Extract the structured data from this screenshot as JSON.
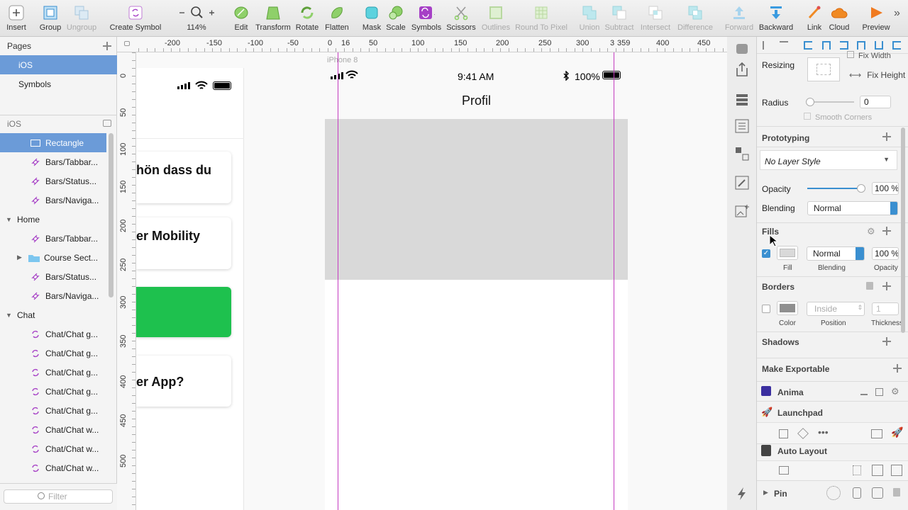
{
  "toolbar": {
    "insert": "Insert",
    "group": "Group",
    "ungroup": "Ungroup",
    "create_symbol": "Create Symbol",
    "zoom": "114%",
    "edit": "Edit",
    "transform": "Transform",
    "rotate": "Rotate",
    "flatten": "Flatten",
    "mask": "Mask",
    "scale": "Scale",
    "symbols": "Symbols",
    "scissors": "Scissors",
    "outlines": "Outlines",
    "round_to_pixel": "Round To Pixel",
    "union": "Union",
    "subtract": "Subtract",
    "intersect": "Intersect",
    "difference": "Difference",
    "forward": "Forward",
    "backward": "Backward",
    "link": "Link",
    "cloud": "Cloud",
    "preview": "Preview"
  },
  "pages": {
    "title": "Pages",
    "items": [
      "iOS",
      "Symbols"
    ],
    "selected": "iOS"
  },
  "layers": {
    "page_name": "iOS",
    "rows": [
      {
        "label": "Rectangle",
        "icon": "rectangle-icon",
        "selected": true
      },
      {
        "label": "Bars/Tabbar...",
        "icon": "symbol-instance-icon"
      },
      {
        "label": "Bars/Status...",
        "icon": "symbol-instance-icon"
      },
      {
        "label": "Bars/Naviga...",
        "icon": "symbol-instance-icon"
      },
      {
        "label": "Home",
        "icon": "artboard-expanded"
      },
      {
        "label": "Bars/Tabbar...",
        "icon": "symbol-instance-icon"
      },
      {
        "label": "Course Sect...",
        "icon": "folder-icon"
      },
      {
        "label": "Bars/Status...",
        "icon": "symbol-instance-icon"
      },
      {
        "label": "Bars/Naviga...",
        "icon": "symbol-instance-icon"
      },
      {
        "label": "Chat",
        "icon": "artboard-expanded"
      },
      {
        "label": "Chat/Chat g...",
        "icon": "symbol-master-icon"
      },
      {
        "label": "Chat/Chat g...",
        "icon": "symbol-master-icon"
      },
      {
        "label": "Chat/Chat g...",
        "icon": "symbol-master-icon"
      },
      {
        "label": "Chat/Chat g...",
        "icon": "symbol-master-icon"
      },
      {
        "label": "Chat/Chat g...",
        "icon": "symbol-master-icon"
      },
      {
        "label": "Chat/Chat w...",
        "icon": "symbol-master-icon"
      },
      {
        "label": "Chat/Chat w...",
        "icon": "symbol-master-icon"
      },
      {
        "label": "Chat/Chat w...",
        "icon": "symbol-master-icon"
      }
    ],
    "filter_placeholder": "Filter"
  },
  "ruler": {
    "h_labels": [
      "-200",
      "-150",
      "-100",
      "-50",
      "0",
      "16",
      "50",
      "100",
      "150",
      "200",
      "250",
      "300",
      "3",
      "359",
      "400",
      "450"
    ],
    "v_labels": [
      "0",
      "50",
      "100",
      "150",
      "200",
      "250",
      "300",
      "350",
      "400",
      "450",
      "500"
    ]
  },
  "canvas": {
    "artboard_label": "iPhone 8",
    "status_time": "9:41 AM",
    "status_battery": "100%",
    "nav_title": "Profil",
    "card1": "hön dass du",
    "card2": "er Mobility",
    "card4": "er App?",
    "card_green_color": "#1ec14e",
    "guide_color": "#c43bc0",
    "placeholder_rect_color": "#d9d9d9"
  },
  "inspector": {
    "resizing": "Resizing",
    "fix_width": "Fix Width",
    "fix_height": "Fix Height",
    "radius_label": "Radius",
    "radius_value": "0",
    "smooth_corners": "Smooth Corners",
    "prototyping": "Prototyping",
    "layer_style": "No Layer Style",
    "opacity_label": "Opacity",
    "opacity_value": "100 %",
    "blending_label": "Blending",
    "blending_value": "Normal",
    "fills": "Fills",
    "fill_blending": "Normal",
    "fill_opacity": "100 %",
    "fill_sub": "Fill",
    "fill_blending_sub": "Blending",
    "fill_opacity_sub": "Opacity",
    "borders": "Borders",
    "border_position": "Inside",
    "border_thickness": "1",
    "border_color_sub": "Color",
    "border_position_sub": "Position",
    "border_thickness_sub": "Thickness",
    "shadows": "Shadows",
    "make_exportable": "Make Exportable",
    "anima": "Anima",
    "launchpad": "Launchpad",
    "auto_layout": "Auto Layout",
    "pin": "Pin"
  }
}
